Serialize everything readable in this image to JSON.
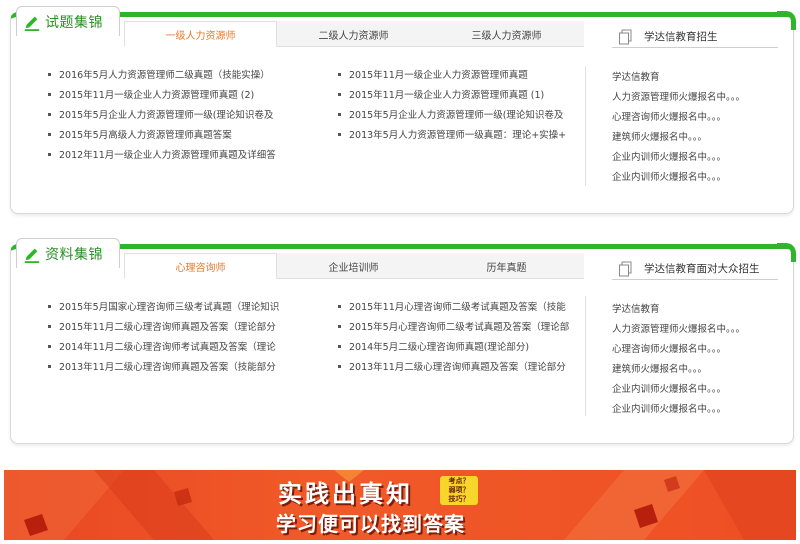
{
  "section1": {
    "title": "试题集锦",
    "tabs": [
      "一级人力资源师",
      "二级人力资源师",
      "三级人力资源师"
    ],
    "side_title": "学达信教育招生",
    "col1": [
      "2016年5月人力资源管理师二级真题（技能实操）",
      "2015年11月一级企业人力资源管理师真题 (2)",
      "2015年5月企业人力资源管理师一级(理论知识卷及",
      "2015年5月高级人力资源管理师真题答案",
      "2012年11月一级企业人力资源管理师真题及详细答"
    ],
    "col2": [
      "2015年11月一级企业人力资源管理师真题",
      "2015年11月一级企业人力资源管理师真题 (1)",
      "2015年5月企业人力资源管理师一级(理论知识卷及",
      "2013年5月人力资源管理师一级真题：理论+实操+"
    ],
    "side_items": [
      "学达信教育",
      "人力资源管理师火爆报名中。。。",
      "心理咨询师火爆报名中。。。",
      "建筑师火爆报名中。。。",
      "企业内训师火爆报名中。。。",
      "企业内训师火爆报名中。。。"
    ]
  },
  "section2": {
    "title": "资料集锦",
    "tabs": [
      "心理咨询师",
      "企业培训师",
      "历年真题"
    ],
    "side_title": "学达信教育面对大众招生",
    "col1": [
      "2015年5月国家心理咨询师三级考试真题（理论知识",
      "2015年11月二级心理咨询师真题及答案（理论部分",
      "2014年11月二级心理咨询师考试真题及答案（理论",
      "2013年11月二级心理咨询师真题及答案（技能部分"
    ],
    "col2": [
      "2015年11月心理咨询师二级考试真题及答案（技能",
      "2015年5月心理咨询师二级考试真题及答案（理论部",
      "2014年5月二级心理咨询师真题(理论部分)",
      "2013年11月二级心理咨询师真题及答案（理论部分"
    ],
    "side_items": [
      "学达信教育",
      "人力资源管理师火爆报名中。。。",
      "心理咨询师火爆报名中。。。",
      "建筑师火爆报名中。。。",
      "企业内训师火爆报名中。。。",
      "企业内训师火爆报名中。。。"
    ]
  },
  "banner": {
    "headline": "实践出真知",
    "subline": "学习便可以找到答案",
    "tags": [
      "考点？",
      "弱项？",
      "技巧？"
    ]
  },
  "colors": {
    "green": "#2fb52c",
    "orange_tab": "#e8792b",
    "banner_red": "#ee4f24"
  },
  "icons": [
    "pencil-icon",
    "document-icon"
  ]
}
